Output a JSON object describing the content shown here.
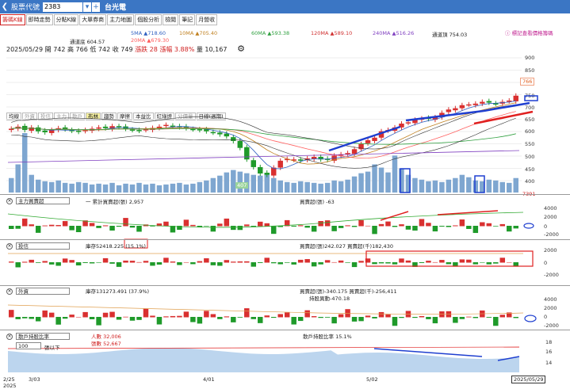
{
  "topbar": {
    "back": "❮",
    "label": "股票代號",
    "code": "2383",
    "dropdown": "▾",
    "plus": "+",
    "name": "台光電"
  },
  "tabs": [
    "籌碼K線",
    "即時走勢",
    "分點K線",
    "大單券商",
    "主力地圖",
    "個股分析",
    "檢閱",
    "筆記",
    "月營收"
  ],
  "active_tab": 0,
  "ma_legend": {
    "ma5": "5MA ▲718.60",
    "ma10": "10MA ▲705.40",
    "ma60": "60MA ▲593.38",
    "ma120": "120MA ▲589.10",
    "ma240": "240MA ▲516.26",
    "channel_top": "通道頂 754.03",
    "channel_bottom": "通道底 604.57",
    "ma20": "20MA ▲679.30",
    "mark_note": "ⓘ 標記查看價格籌碼"
  },
  "info": {
    "date": "2025/05/29",
    "open": "開 742",
    "high": "高 766",
    "low": "低 742",
    "close": "收 749",
    "change": "漲跌 28",
    "pct": "漲幅 3.88%",
    "volume": "量 10,167"
  },
  "price_tabs": [
    "均線",
    "外資",
    "投信",
    "主力",
    "散戶",
    "布林",
    "趨勢",
    "摩擦",
    "本益比",
    "紅綠燈",
    "分價量",
    "日線(週期)"
  ],
  "price_tab_states": [
    "n",
    "d",
    "d",
    "d",
    "d",
    "h",
    "n",
    "n",
    "n",
    "n",
    "d",
    "n"
  ],
  "price_axis": [
    "900",
    "850",
    "800",
    "750",
    "700",
    "650",
    "600",
    "550",
    "500",
    "450",
    "400"
  ],
  "high_tag": "766",
  "low_tag": "407",
  "volume_tag": "7391",
  "panel1": {
    "select": "主力買賣超",
    "legend1": "一 累計買賣超(張) 2,957",
    "legend2": "買賣超(張) -63",
    "axis": [
      "4000",
      "2000",
      "0",
      "-2000",
      "-4000"
    ]
  },
  "panel2": {
    "select": "投信",
    "legend1": "庫存52418.225 (15.1%)",
    "legend2": "買賣超(張)242.027 買賣超(千)182,430",
    "axis": [
      "2000",
      "0",
      "-2000"
    ]
  },
  "panel3": {
    "select": "外資",
    "legend1": "庫存131273.491 (37.9%)",
    "legend2": "買賣超(張)-340.175 買賣超(千)-256,411",
    "legend3": "持股異動-470.18",
    "axis": [
      "4000",
      "2000",
      "0",
      "-2000",
      "-4000"
    ]
  },
  "panel4": {
    "select": "散戶持股比率",
    "legend1": "人數 32,006",
    "legend2": "張數 52,667",
    "legend3": "散戶持股比率 15.1%",
    "sub_select": "100",
    "sub_label": "張以下",
    "axis": [
      "18",
      "16",
      "14"
    ]
  },
  "x_labels": [
    "2/25\n2025",
    "3/03",
    "4/01",
    "5/02"
  ],
  "current_date": "2025/05/29",
  "colors": {
    "up": "#d93030",
    "down": "#1f9a2a",
    "volume": "#7ea6d0",
    "brand": "#3b76c4"
  },
  "chart_data": {
    "type": "candlestick",
    "price_range": [
      380,
      900
    ],
    "candles_close": [
      620,
      628,
      615,
      625,
      610,
      606,
      615,
      622,
      618,
      612,
      608,
      615,
      620,
      625,
      622,
      630,
      626,
      620,
      615,
      612,
      618,
      623,
      628,
      635,
      630,
      626,
      622,
      618,
      615,
      610,
      605,
      598,
      590,
      572,
      545,
      500,
      470,
      445,
      440,
      468,
      495,
      502,
      500,
      495,
      504,
      510,
      500,
      498,
      515,
      520,
      525,
      540,
      560,
      575,
      585,
      610,
      615,
      625,
      640,
      645,
      655,
      660,
      658,
      665,
      682,
      695,
      700,
      712,
      715,
      718,
      725,
      722,
      718,
      725,
      730,
      749
    ],
    "volume": [
      1800,
      3500,
      7391,
      2200,
      1600,
      1400,
      1300,
      1500,
      1200,
      1100,
      1300,
      1200,
      1000,
      1100,
      1000,
      1200,
      900,
      1100,
      1000,
      1200,
      1000,
      1100,
      900,
      1000,
      1100,
      1200,
      1000,
      1100,
      1300,
      1500,
      1800,
      2100,
      2500,
      2800,
      2600,
      2400,
      2200,
      2100,
      2300,
      1800,
      1500,
      1300,
      1200,
      1400,
      1300,
      1200,
      1100,
      1200,
      1500,
      1400,
      1600,
      2000,
      2400,
      2600,
      3500,
      3100,
      2500,
      4600,
      3000,
      2200,
      1800,
      1600,
      1400,
      1500,
      1300,
      1600,
      1800,
      2200,
      1900,
      1500,
      1400,
      1600,
      1500,
      1300,
      1200,
      1800
    ]
  }
}
